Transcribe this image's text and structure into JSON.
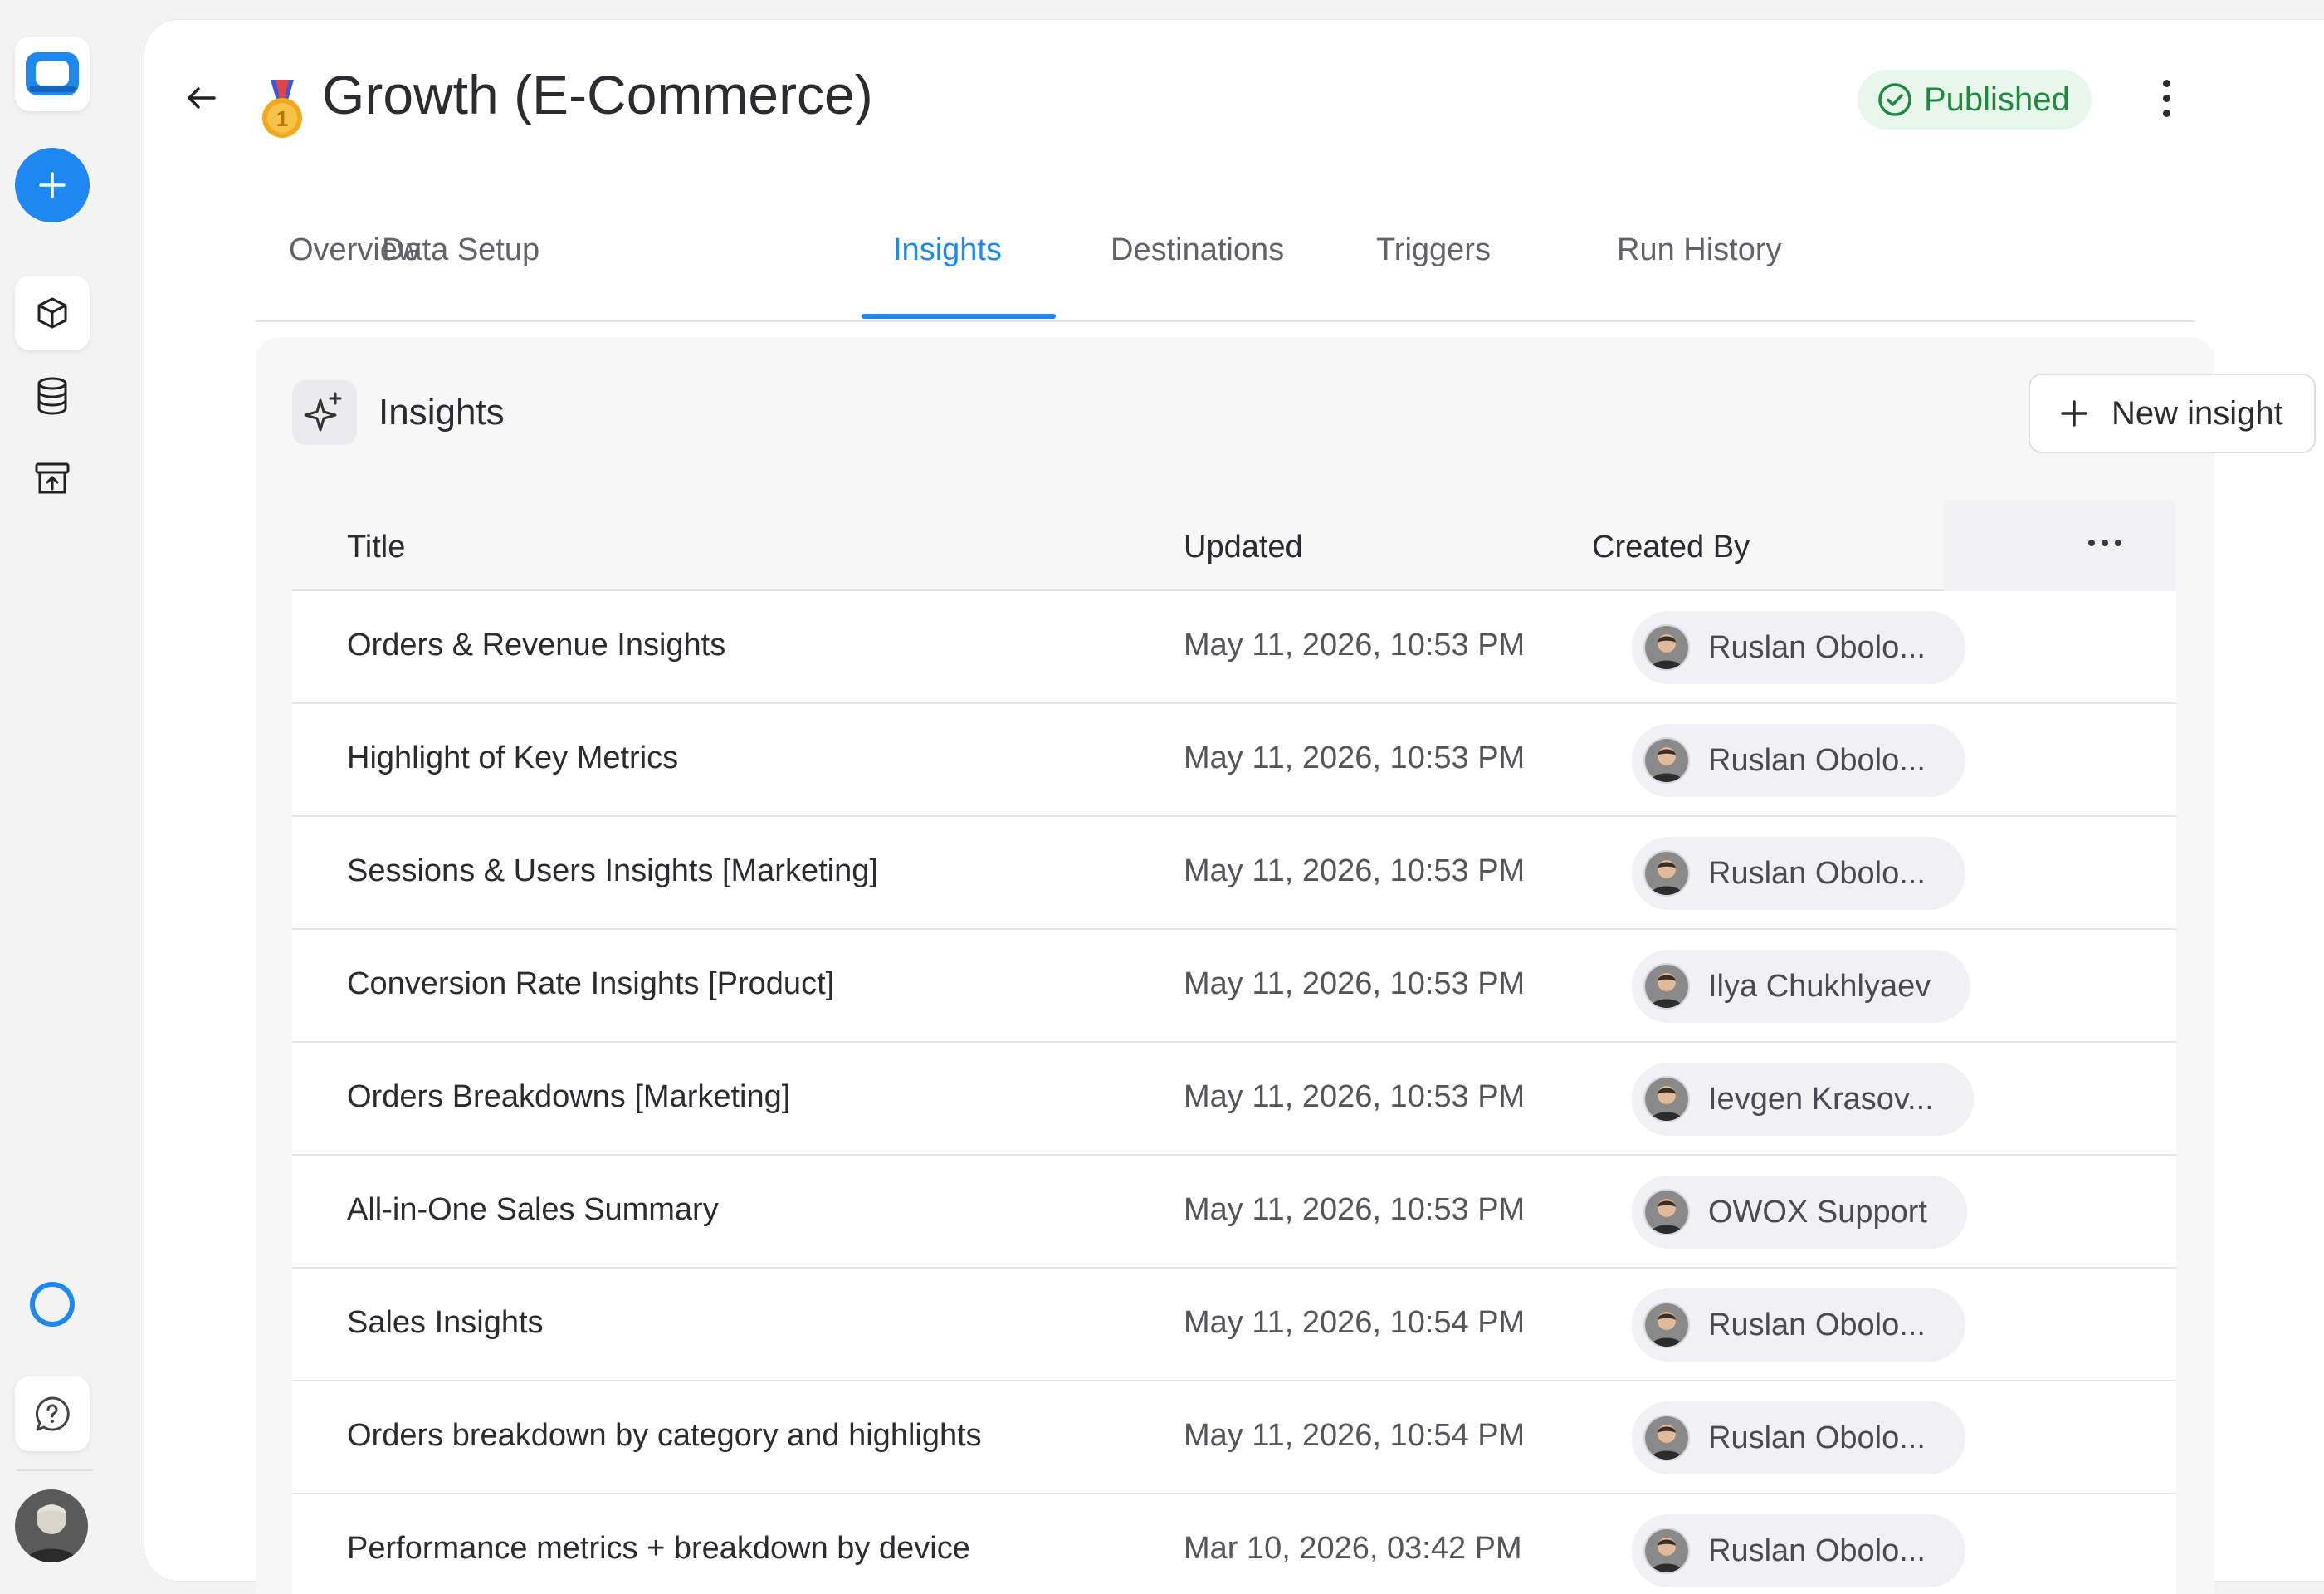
{
  "page": {
    "title": "Growth (E-Commerce)",
    "status": "Published",
    "medal_icon": "medal-icon",
    "accent_color": "#1e88f0",
    "status_color": "#1d8a3f"
  },
  "tabs": [
    {
      "label": "Overview"
    },
    {
      "label": "Data Setup"
    },
    {
      "label": "Insights"
    },
    {
      "label": "Destinations"
    },
    {
      "label": "Triggers"
    },
    {
      "label": "Run History"
    }
  ],
  "active_tab": "Insights",
  "insights": {
    "title": "Insights",
    "new_button": "New insight",
    "columns": {
      "title": "Title",
      "updated": "Updated",
      "created_by": "Created By"
    },
    "rows": [
      {
        "title": "Orders & Revenue Insights",
        "updated": "May 11, 2026, 10:53 PM",
        "created_by": "Ruslan Obolo..."
      },
      {
        "title": "Highlight of Key Metrics",
        "updated": "May 11, 2026, 10:53 PM",
        "created_by": "Ruslan Obolo..."
      },
      {
        "title": "Sessions & Users Insights [Marketing]",
        "updated": "May 11, 2026, 10:53 PM",
        "created_by": "Ruslan Obolo..."
      },
      {
        "title": "Conversion Rate Insights [Product]",
        "updated": "May 11, 2026, 10:53 PM",
        "created_by": "Ilya Chukhlyaev"
      },
      {
        "title": "Orders Breakdowns [Marketing]",
        "updated": "May 11, 2026, 10:53 PM",
        "created_by": "Ievgen Krasov..."
      },
      {
        "title": "All-in-One Sales Summary",
        "updated": "May 11, 2026, 10:53 PM",
        "created_by": "OWOX Support"
      },
      {
        "title": "Sales Insights",
        "updated": "May 11, 2026, 10:54 PM",
        "created_by": "Ruslan Obolo..."
      },
      {
        "title": "Orders breakdown by category and highlights",
        "updated": "May 11, 2026, 10:54 PM",
        "created_by": "Ruslan Obolo..."
      },
      {
        "title": "Performance metrics + breakdown by device",
        "updated": "Mar 10, 2026, 03:42 PM",
        "created_by": "Ruslan Obolo..."
      }
    ]
  },
  "sidebar": {
    "icons": [
      "app-logo-icon",
      "plus-icon",
      "cube-icon",
      "database-icon",
      "archive-upload-icon",
      "status-ring-icon",
      "help-chat-icon"
    ]
  }
}
